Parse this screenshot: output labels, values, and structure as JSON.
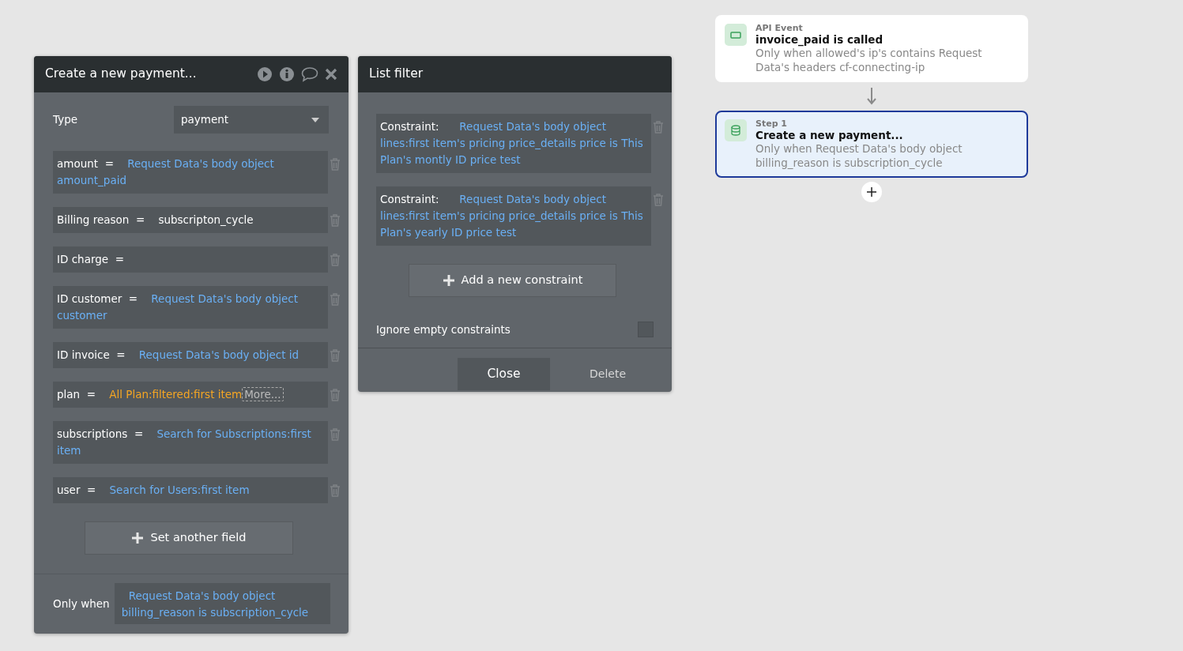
{
  "editor_panel": {
    "title": "Create a new payment...",
    "type_field": {
      "label": "Type",
      "value": "payment"
    },
    "fields": [
      {
        "kind": "expression",
        "label": "amount",
        "operator": "=",
        "value": "Request Data's body object amount_paid"
      },
      {
        "kind": "text",
        "label": "Billing reason",
        "operator": "=",
        "value": "subscripton_cycle"
      },
      {
        "kind": "empty",
        "label": "ID charge",
        "operator": "="
      },
      {
        "kind": "expression",
        "label": "ID customer",
        "operator": "=",
        "value": "Request Data's body object customer"
      },
      {
        "kind": "expression",
        "label": "ID invoice",
        "operator": "=",
        "value": "Request Data's body object id"
      },
      {
        "kind": "filter",
        "label": "plan",
        "operator": "=",
        "value": "All Plan:filtered:first item",
        "more": "More..."
      },
      {
        "kind": "expression",
        "label": "subscriptions",
        "operator": "=",
        "value": "Search for Subscriptions:first item"
      },
      {
        "kind": "expression",
        "label": "user",
        "operator": "=",
        "value": "Search for Users:first item"
      }
    ],
    "add_button": "Set another field",
    "only_when": {
      "label": "Only when",
      "value": "Request Data's body object billing_reason is subscription_cycle"
    }
  },
  "list_filter": {
    "title": "List filter",
    "constraints": [
      {
        "label": "Constraint:",
        "value": "Request Data's body object lines:first item's pricing price_details price is This Plan's montly ID price test"
      },
      {
        "label": "Constraint:",
        "value": "Request Data's body object lines:first item's pricing price_details price is This Plan's yearly ID price test"
      }
    ],
    "add_button": "Add a new constraint",
    "ignore_empty": {
      "label": "Ignore empty constraints",
      "checked": false
    },
    "buttons": [
      {
        "kind": "primary",
        "label": "Close"
      },
      {
        "kind": "plain",
        "label": "Delete"
      }
    ]
  },
  "workflow": {
    "cards": [
      {
        "kind": "event",
        "category": "API Event",
        "title": "invoice_paid is called",
        "condition": "Only when allowed's ip's contains Request Data's headers cf-connecting-ip",
        "selected": false
      },
      {
        "kind": "action",
        "category": "Step 1",
        "title": "Create a new payment...",
        "condition": "Only when Request Data's body object billing_reason is subscription_cycle",
        "selected": true
      }
    ]
  }
}
